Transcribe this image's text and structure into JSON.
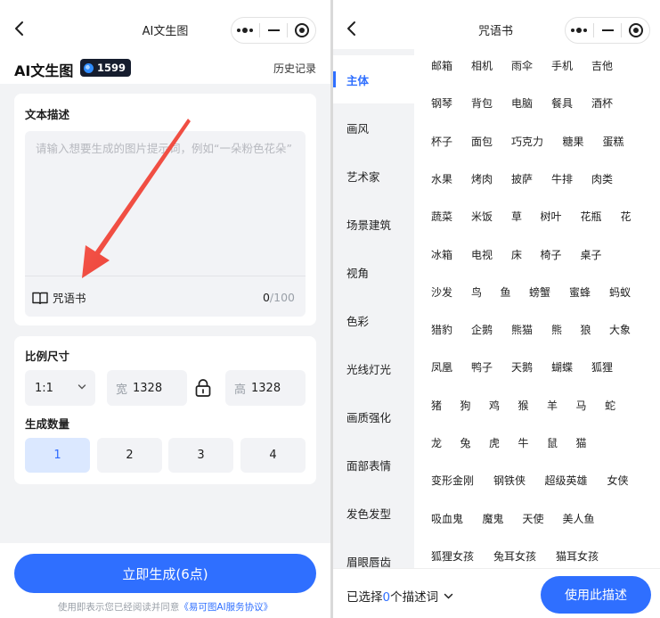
{
  "left": {
    "nav": {
      "title": "AI文生图"
    },
    "header": {
      "title": "AI文生图",
      "credits": "1599",
      "history": "历史记录"
    },
    "prompt_card": {
      "label": "文本描述",
      "placeholder": "请输入想要生成的图片提示词，例如“一朵粉色花朵”",
      "value": "",
      "spellbook": "咒语书",
      "count_current": "0",
      "count_max": "/100"
    },
    "size_card": {
      "label": "比例尺寸",
      "ratio": "1:1",
      "width_label": "宽",
      "width_value": "1328",
      "height_label": "高",
      "height_value": "1328",
      "count_label": "生成数量",
      "counts": [
        "1",
        "2",
        "3",
        "4"
      ],
      "selected_count": "1"
    },
    "footer": {
      "generate": "立即生成(6点)",
      "agree_prefix": "使用即表示您已经阅读并同意",
      "agree_link": "《易可图AI服务协议》"
    }
  },
  "right": {
    "nav": {
      "title": "咒语书"
    },
    "categories": [
      "主体",
      "画风",
      "艺术家",
      "场景建筑",
      "视角",
      "色彩",
      "光线灯光",
      "画质强化",
      "面部表情",
      "发色发型",
      "眉眼唇齿"
    ],
    "active_category": "主体",
    "tag_rows": [
      [
        "邮箱",
        "相机",
        "雨伞",
        "手机",
        "吉他"
      ],
      [
        "钢琴",
        "背包",
        "电脑",
        "餐具",
        "酒杯"
      ],
      [
        "杯子",
        "面包",
        "巧克力",
        "糖果",
        "蛋糕"
      ],
      [
        "水果",
        "烤肉",
        "披萨",
        "牛排",
        "肉类"
      ],
      [
        "蔬菜",
        "米饭",
        "草",
        "树叶",
        "花瓶",
        "花"
      ],
      [
        "冰箱",
        "电视",
        "床",
        "椅子",
        "桌子"
      ],
      [
        "沙发",
        "鸟",
        "鱼",
        "螃蟹",
        "蜜蜂",
        "蚂蚁"
      ],
      [
        "猎豹",
        "企鹅",
        "熊猫",
        "熊",
        "狼",
        "大象"
      ],
      [
        "凤凰",
        "鸭子",
        "天鹅",
        "蝴蝶",
        "狐狸"
      ],
      [
        "猪",
        "狗",
        "鸡",
        "猴",
        "羊",
        "马",
        "蛇"
      ],
      [
        "龙",
        "兔",
        "虎",
        "牛",
        "鼠",
        "猫"
      ],
      [
        "变形金刚",
        "钢铁侠",
        "超级英雄",
        "女侠"
      ],
      [
        "吸血鬼",
        "魔鬼",
        "天使",
        "美人鱼"
      ],
      [
        "狐狸女孩",
        "兔耳女孩",
        "猫耳女孩"
      ]
    ],
    "footer": {
      "selected_prefix": "已选择",
      "selected_count": "0",
      "selected_suffix": "个描述词",
      "use_button": "使用此描述"
    }
  },
  "colors": {
    "accent": "#2f6fff",
    "arrow": "#f0433a",
    "panel_bg": "#f2f3f5"
  }
}
